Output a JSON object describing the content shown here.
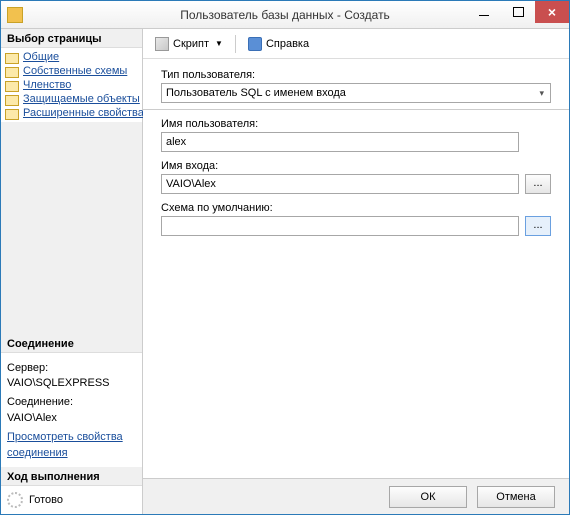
{
  "window": {
    "title": "Пользователь базы данных - Создать"
  },
  "sidebar": {
    "pages_header": "Выбор страницы",
    "pages": [
      {
        "label": "Общие"
      },
      {
        "label": "Собственные схемы"
      },
      {
        "label": "Членство"
      },
      {
        "label": "Защищаемые объекты"
      },
      {
        "label": "Расширенные свойства"
      }
    ],
    "connection_header": "Соединение",
    "connection": {
      "server_label": "Сервер:",
      "server_value": "VAIO\\SQLEXPRESS",
      "conn_label": "Соединение:",
      "conn_value": "VAIO\\Alex",
      "view_link": "Просмотреть свойства соединения"
    },
    "progress_header": "Ход выполнения",
    "progress_status": "Готово"
  },
  "toolbar": {
    "script_label": "Скрипт",
    "help_label": "Справка"
  },
  "form": {
    "user_type_label": "Тип пользователя:",
    "user_type_value": "Пользователь SQL с именем входа",
    "username_label": "Имя пользователя:",
    "username_value": "alex",
    "login_label": "Имя входа:",
    "login_value": "VAIO\\Alex",
    "schema_label": "Схема по умолчанию:",
    "schema_value": "",
    "browse_label": "..."
  },
  "footer": {
    "ok": "ОК",
    "cancel": "Отмена"
  }
}
